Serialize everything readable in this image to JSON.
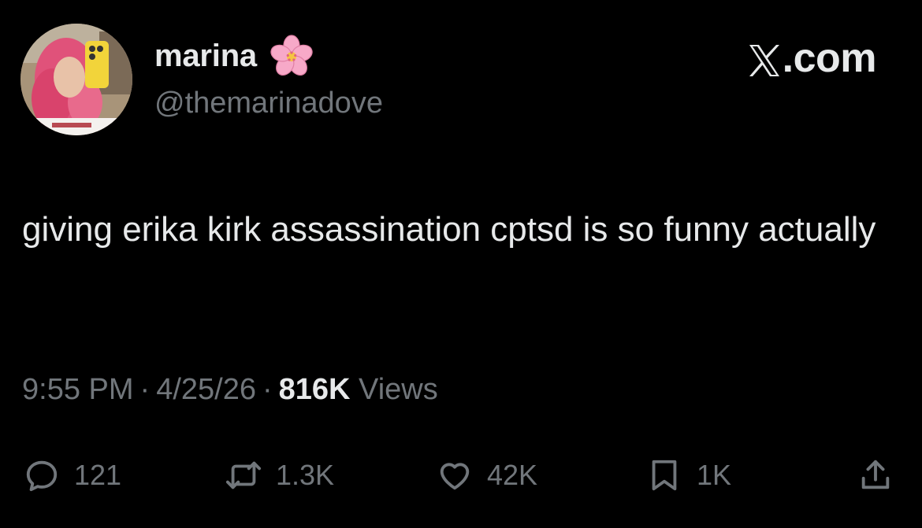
{
  "author": {
    "display_name": "marina",
    "emoji_icon": "cherry-blossom-icon",
    "handle": "@themarinadove"
  },
  "brand": {
    "label": ".com",
    "icon": "x-logo-icon"
  },
  "tweet": {
    "text": "giving erika kirk assassination cptsd is so funny actually",
    "time": "9:55 PM",
    "separator": "·",
    "date": "4/25/26",
    "views_count": "816K",
    "views_label": "Views"
  },
  "actions": {
    "replies": "121",
    "reposts": "1.3K",
    "likes": "42K",
    "bookmarks": "1K"
  },
  "colors": {
    "background": "#000000",
    "primary_text": "#e7e9ea",
    "secondary_text": "#71767b"
  }
}
